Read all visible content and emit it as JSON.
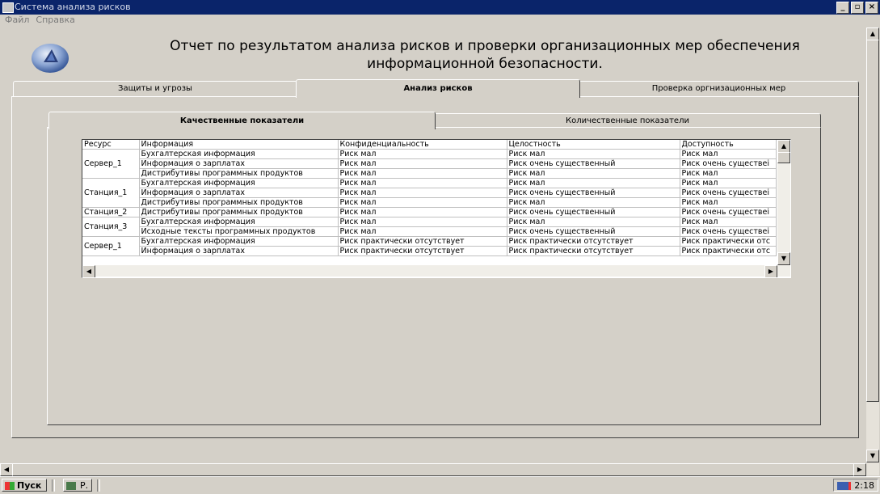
{
  "window": {
    "title": "Система анализа рисков"
  },
  "menu": [
    "Файл",
    "Справка"
  ],
  "report_title_line1": "Отчет по результатом анализа рисков и проверки организационных мер обеспечения",
  "report_title_line2": "информационной безопасности.",
  "outer_tabs": [
    "Защиты и угрозы",
    "Анализ рисков",
    "Проверка оргнизационных мер"
  ],
  "outer_active": 1,
  "inner_tabs": [
    "Качественные показатели",
    "Количественные показатели"
  ],
  "inner_active": 0,
  "grid": {
    "headers": [
      "Ресурс",
      "Информация",
      "Конфиденциальность",
      "Целостность",
      "Доступность"
    ],
    "groups": [
      {
        "resource": "Сервер_1",
        "rows": [
          [
            "Бухгалтерская информация",
            "Риск мал",
            "Риск мал",
            "Риск мал"
          ],
          [
            "Информация о зарплатах",
            "Риск мал",
            "Риск очень существенный",
            "Риск очень существеі"
          ],
          [
            "Дистрибутивы программных продуктов",
            "Риск мал",
            "Риск мал",
            "Риск мал"
          ]
        ]
      },
      {
        "resource": "Станция_1",
        "rows": [
          [
            "Бухгалтерская информация",
            "Риск мал",
            "Риск мал",
            "Риск мал"
          ],
          [
            "Информация о зарплатах",
            "Риск мал",
            "Риск очень существенный",
            "Риск очень существеі"
          ],
          [
            "Дистрибутивы программных продуктов",
            "Риск мал",
            "Риск мал",
            "Риск мал"
          ]
        ]
      },
      {
        "resource": "Станция_2",
        "rows": [
          [
            "Дистрибутивы программных продуктов",
            "Риск мал",
            "Риск очень существенный",
            "Риск очень существеі"
          ]
        ]
      },
      {
        "resource": "Станция_3",
        "rows": [
          [
            "Бухгалтерская информация",
            "Риск мал",
            "Риск мал",
            "Риск мал"
          ],
          [
            "Исходные тексты программных продуктов",
            "Риск мал",
            "Риск очень существенный",
            "Риск очень существеі"
          ]
        ]
      },
      {
        "resource": "Сервер_1",
        "rows": [
          [
            "Бухгалтерская информация",
            "Риск практически отсутствует",
            "Риск практически отсутствует",
            "Риск практически отс"
          ],
          [
            "Информация о зарплатах",
            "Риск практически отсутствует",
            "Риск практически отсутствует",
            "Риск практически отс"
          ]
        ]
      }
    ]
  },
  "taskbar": {
    "start_label": "Пуск",
    "task_label": "Р.",
    "clock": "2:18"
  }
}
